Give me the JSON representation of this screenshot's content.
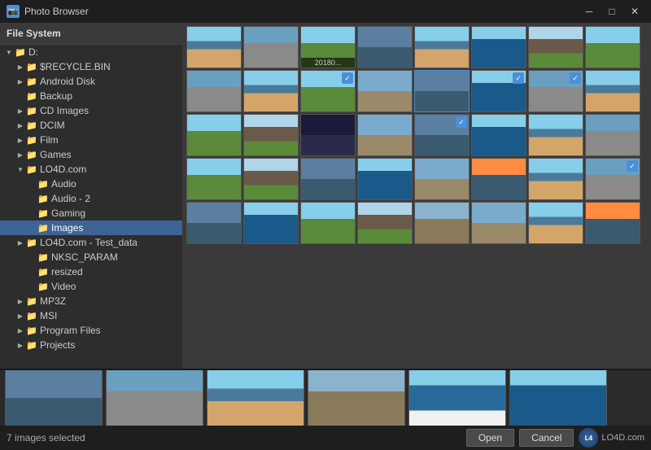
{
  "titleBar": {
    "title": "Photo Browser",
    "iconLabel": "📷",
    "minBtn": "─",
    "maxBtn": "□",
    "closeBtn": "✕"
  },
  "sidebar": {
    "header": "File System",
    "tree": [
      {
        "id": "drive-d",
        "label": "D:",
        "indent": 1,
        "arrow": "▼",
        "hasArrow": true,
        "selected": false
      },
      {
        "id": "recycle",
        "label": "$RECYCLE.BIN",
        "indent": 2,
        "arrow": "▶",
        "hasArrow": true,
        "selected": false
      },
      {
        "id": "android",
        "label": "Android Disk",
        "indent": 2,
        "arrow": "▶",
        "hasArrow": true,
        "selected": false
      },
      {
        "id": "backup",
        "label": "Backup",
        "indent": 2,
        "arrow": "",
        "hasArrow": false,
        "selected": false
      },
      {
        "id": "cd-images",
        "label": "CD Images",
        "indent": 2,
        "arrow": "▶",
        "hasArrow": true,
        "selected": false
      },
      {
        "id": "dcim",
        "label": "DCIM",
        "indent": 2,
        "arrow": "▶",
        "hasArrow": true,
        "selected": false
      },
      {
        "id": "film",
        "label": "Film",
        "indent": 2,
        "arrow": "▶",
        "hasArrow": true,
        "selected": false
      },
      {
        "id": "games",
        "label": "Games",
        "indent": 2,
        "arrow": "▶",
        "hasArrow": true,
        "selected": false
      },
      {
        "id": "lo4d",
        "label": "LO4D.com",
        "indent": 2,
        "arrow": "▼",
        "hasArrow": true,
        "selected": false
      },
      {
        "id": "audio",
        "label": "Audio",
        "indent": 3,
        "arrow": "",
        "hasArrow": false,
        "selected": false
      },
      {
        "id": "audio2",
        "label": "Audio - 2",
        "indent": 3,
        "arrow": "",
        "hasArrow": false,
        "selected": false
      },
      {
        "id": "gaming",
        "label": "Gaming",
        "indent": 3,
        "arrow": "",
        "hasArrow": false,
        "selected": false
      },
      {
        "id": "images",
        "label": "Images",
        "indent": 3,
        "arrow": "",
        "hasArrow": false,
        "selected": true
      },
      {
        "id": "lo4d-test",
        "label": "LO4D.com - Test_data",
        "indent": 2,
        "arrow": "▶",
        "hasArrow": true,
        "selected": false
      },
      {
        "id": "nksc",
        "label": "NKSC_PARAM",
        "indent": 3,
        "arrow": "",
        "hasArrow": false,
        "selected": false
      },
      {
        "id": "resized",
        "label": "resized",
        "indent": 3,
        "arrow": "",
        "hasArrow": false,
        "selected": false
      },
      {
        "id": "video",
        "label": "Video",
        "indent": 3,
        "arrow": "",
        "hasArrow": false,
        "selected": false
      },
      {
        "id": "mp3z",
        "label": "MP3Z",
        "indent": 2,
        "arrow": "▶",
        "hasArrow": true,
        "selected": false
      },
      {
        "id": "msi",
        "label": "MSI",
        "indent": 2,
        "arrow": "▶",
        "hasArrow": true,
        "selected": false
      },
      {
        "id": "program-files",
        "label": "Program Files",
        "indent": 2,
        "arrow": "▶",
        "hasArrow": true,
        "selected": false
      },
      {
        "id": "projects",
        "label": "Projects",
        "indent": 2,
        "arrow": "▶",
        "hasArrow": true,
        "selected": false
      }
    ]
  },
  "grid": {
    "thumbs": [
      {
        "id": 1,
        "label": "",
        "type": "photo-beach",
        "selected": false,
        "checked": false
      },
      {
        "id": 2,
        "label": "",
        "type": "photo-city",
        "selected": false,
        "checked": false
      },
      {
        "id": 3,
        "label": "20180...",
        "type": "photo-sky",
        "selected": false,
        "checked": false,
        "showLabel": true
      },
      {
        "id": 4,
        "label": "",
        "type": "photo-harbor",
        "selected": false,
        "checked": false
      },
      {
        "id": 5,
        "label": "",
        "type": "photo-beach",
        "selected": false,
        "checked": false
      },
      {
        "id": 6,
        "label": "",
        "type": "photo-sea",
        "selected": false,
        "checked": false
      },
      {
        "id": 7,
        "label": "",
        "type": "photo-mountain",
        "selected": false,
        "checked": false
      },
      {
        "id": 8,
        "label": "",
        "type": "photo-sky",
        "selected": false,
        "checked": false
      },
      {
        "id": 9,
        "label": "",
        "type": "photo-city",
        "selected": false,
        "checked": false
      },
      {
        "id": 10,
        "label": "",
        "type": "photo-beach",
        "selected": false,
        "checked": false
      },
      {
        "id": 11,
        "label": "",
        "type": "photo-sky",
        "selected": false,
        "checked": true
      },
      {
        "id": 12,
        "label": "",
        "type": "photo-ruins",
        "selected": false,
        "checked": false
      },
      {
        "id": 13,
        "label": "",
        "type": "photo-harbor",
        "selected": true,
        "checked": false
      },
      {
        "id": 14,
        "label": "",
        "type": "photo-sea",
        "selected": false,
        "checked": true
      },
      {
        "id": 15,
        "label": "",
        "type": "photo-city",
        "selected": false,
        "checked": true
      },
      {
        "id": 16,
        "label": "",
        "type": "photo-beach",
        "selected": false,
        "checked": false
      },
      {
        "id": 17,
        "label": "",
        "type": "photo-sky",
        "selected": false,
        "checked": false
      },
      {
        "id": 18,
        "label": "",
        "type": "photo-mountain",
        "selected": false,
        "checked": false
      },
      {
        "id": 19,
        "label": "",
        "type": "photo-night",
        "selected": false,
        "checked": false
      },
      {
        "id": 20,
        "label": "",
        "type": "photo-ruins",
        "selected": false,
        "checked": false
      },
      {
        "id": 21,
        "label": "",
        "type": "photo-harbor",
        "selected": false,
        "checked": true
      },
      {
        "id": 22,
        "label": "",
        "type": "photo-sea",
        "selected": false,
        "checked": false
      },
      {
        "id": 23,
        "label": "",
        "type": "photo-beach",
        "selected": false,
        "checked": false
      },
      {
        "id": 24,
        "label": "",
        "type": "photo-city",
        "selected": false,
        "checked": false
      },
      {
        "id": 25,
        "label": "",
        "type": "photo-sky",
        "selected": false,
        "checked": false
      },
      {
        "id": 26,
        "label": "",
        "type": "photo-mountain",
        "selected": false,
        "checked": false
      },
      {
        "id": 27,
        "label": "",
        "type": "photo-harbor",
        "selected": false,
        "checked": false
      },
      {
        "id": 28,
        "label": "",
        "type": "photo-sea",
        "selected": false,
        "checked": false
      },
      {
        "id": 29,
        "label": "",
        "type": "photo-ruins",
        "selected": false,
        "checked": false
      },
      {
        "id": 30,
        "label": "",
        "type": "photo-sunset",
        "selected": false,
        "checked": false
      },
      {
        "id": 31,
        "label": "",
        "type": "photo-beach",
        "selected": false,
        "checked": false
      },
      {
        "id": 32,
        "label": "",
        "type": "photo-city",
        "selected": false,
        "checked": true
      },
      {
        "id": 33,
        "label": "",
        "type": "photo-harbor",
        "selected": false,
        "checked": false
      },
      {
        "id": 34,
        "label": "",
        "type": "photo-sea",
        "selected": false,
        "checked": false
      },
      {
        "id": 35,
        "label": "",
        "type": "photo-sky",
        "selected": false,
        "checked": false
      },
      {
        "id": 36,
        "label": "",
        "type": "photo-mountain",
        "selected": false,
        "checked": false
      },
      {
        "id": 37,
        "label": "",
        "type": "photo-church",
        "selected": false,
        "checked": false
      },
      {
        "id": 38,
        "label": "",
        "type": "photo-ruins",
        "selected": false,
        "checked": false
      },
      {
        "id": 39,
        "label": "",
        "type": "photo-beach",
        "selected": false,
        "checked": false
      },
      {
        "id": 40,
        "label": "",
        "type": "photo-sunset",
        "selected": false,
        "checked": false
      }
    ]
  },
  "bottomStrip": {
    "images": [
      {
        "id": 1,
        "type": "photo-harbor"
      },
      {
        "id": 2,
        "type": "photo-city"
      },
      {
        "id": 3,
        "type": "photo-beach"
      },
      {
        "id": 4,
        "type": "photo-church"
      },
      {
        "id": 5,
        "type": "photo-cruise"
      },
      {
        "id": 6,
        "type": "photo-sea"
      }
    ],
    "status": "7 images selected",
    "openBtn": "Open",
    "cancelBtn": "Cancel",
    "logoText": "LO4D.com"
  }
}
